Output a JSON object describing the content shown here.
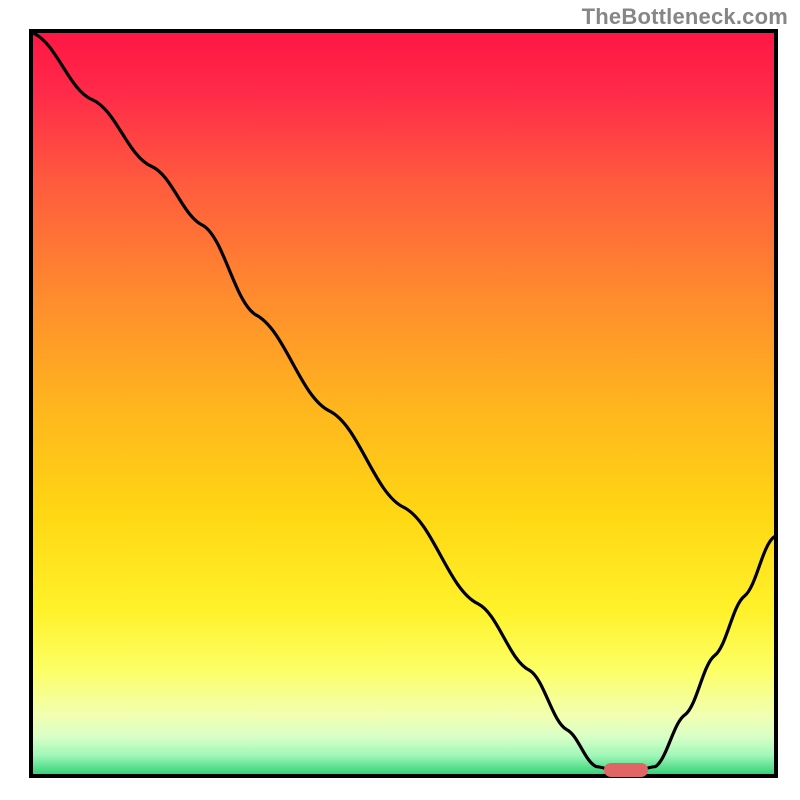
{
  "watermark": "TheBottleneck.com",
  "chart_data": {
    "type": "line",
    "title": "",
    "xlabel": "",
    "ylabel": "",
    "xlim": [
      0,
      100
    ],
    "ylim": [
      0,
      100
    ],
    "series": [
      {
        "name": "bottleneck-curve",
        "x": [
          0,
          8,
          16,
          23,
          30,
          40,
          50,
          60,
          67,
          72,
          76,
          80,
          84,
          88,
          92,
          96,
          100
        ],
        "y": [
          100,
          91,
          82,
          74,
          62,
          49,
          36,
          23,
          14,
          6,
          1,
          0,
          1,
          8,
          16,
          24,
          32
        ]
      }
    ],
    "marker": {
      "name": "optimal-range",
      "x_start": 77,
      "x_end": 83,
      "y": 0.5
    },
    "gradient_stops": [
      {
        "offset": 0.0,
        "color": "#ff1744"
      },
      {
        "offset": 0.08,
        "color": "#ff2a49"
      },
      {
        "offset": 0.2,
        "color": "#ff5a3e"
      },
      {
        "offset": 0.35,
        "color": "#ff8a2e"
      },
      {
        "offset": 0.5,
        "color": "#ffb41e"
      },
      {
        "offset": 0.65,
        "color": "#ffd713"
      },
      {
        "offset": 0.78,
        "color": "#fff22a"
      },
      {
        "offset": 0.86,
        "color": "#fcff66"
      },
      {
        "offset": 0.92,
        "color": "#f2ffb0"
      },
      {
        "offset": 0.95,
        "color": "#d8ffc6"
      },
      {
        "offset": 0.975,
        "color": "#a0f7b8"
      },
      {
        "offset": 1.0,
        "color": "#36d278"
      }
    ]
  }
}
